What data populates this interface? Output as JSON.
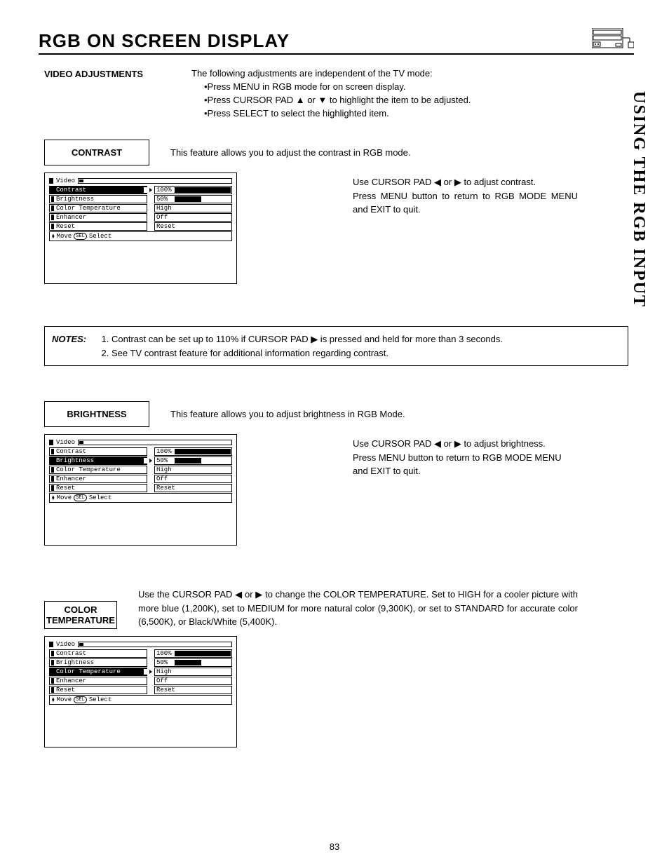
{
  "title": "RGB ON SCREEN DISPLAY",
  "side_label": "USING THE RGB INPUT",
  "page_number": "83",
  "intro": {
    "label": "VIDEO ADJUSTMENTS",
    "line1": "The following adjustments are independent of the TV mode:",
    "b1": "•Press MENU in RGB mode for on screen display.",
    "b2": "•Press CURSOR PAD ▲ or ▼ to highlight the item to be adjusted.",
    "b3": "•Press SELECT to select the highlighted item."
  },
  "contrast": {
    "box_label": "CONTRAST",
    "desc": "This feature allows you to adjust the contrast in RGB mode.",
    "instr1": "Use CURSOR PAD ◀ or ▶ to adjust contrast.",
    "instr2": "Press MENU button to return to RGB MODE MENU and EXIT to quit."
  },
  "brightness": {
    "box_label": "BRIGHTNESS",
    "desc": "This feature allows you to adjust brightness in RGB Mode.",
    "instr1": "Use CURSOR PAD ◀ or ▶ to adjust brightness.",
    "instr2": "Press MENU button to return to RGB MODE MENU and EXIT to quit."
  },
  "color_temp": {
    "box_line1": "COLOR",
    "box_line2": "TEMPERATURE",
    "desc": "Use the CURSOR PAD ◀ or ▶ to change the COLOR TEMPERATURE.  Set to HIGH for a cooler picture with more blue (1,200K), set to MEDIUM for more natural color (9,300K), or set to STANDARD for accurate color (6,500K), or Black/White (5,400K)."
  },
  "osd": {
    "title": "Video",
    "items": {
      "contrast": "Contrast",
      "brightness": "Brightness",
      "color_temp": "Color Temperature",
      "enhancer": "Enhancer",
      "reset": "Reset"
    },
    "values": {
      "contrast": "100%",
      "brightness": "50%",
      "color_temp": "High",
      "enhancer": "Off",
      "reset": "Reset"
    },
    "footer_move": "Move",
    "footer_sel_glyph": "SEL",
    "footer_select": "Select"
  },
  "notes": {
    "label": "NOTES:",
    "n1": "Contrast can be set up to 110% if CURSOR PAD ▶ is pressed and held for more than 3 seconds.",
    "n2": "See TV contrast feature for additional information regarding contrast."
  }
}
